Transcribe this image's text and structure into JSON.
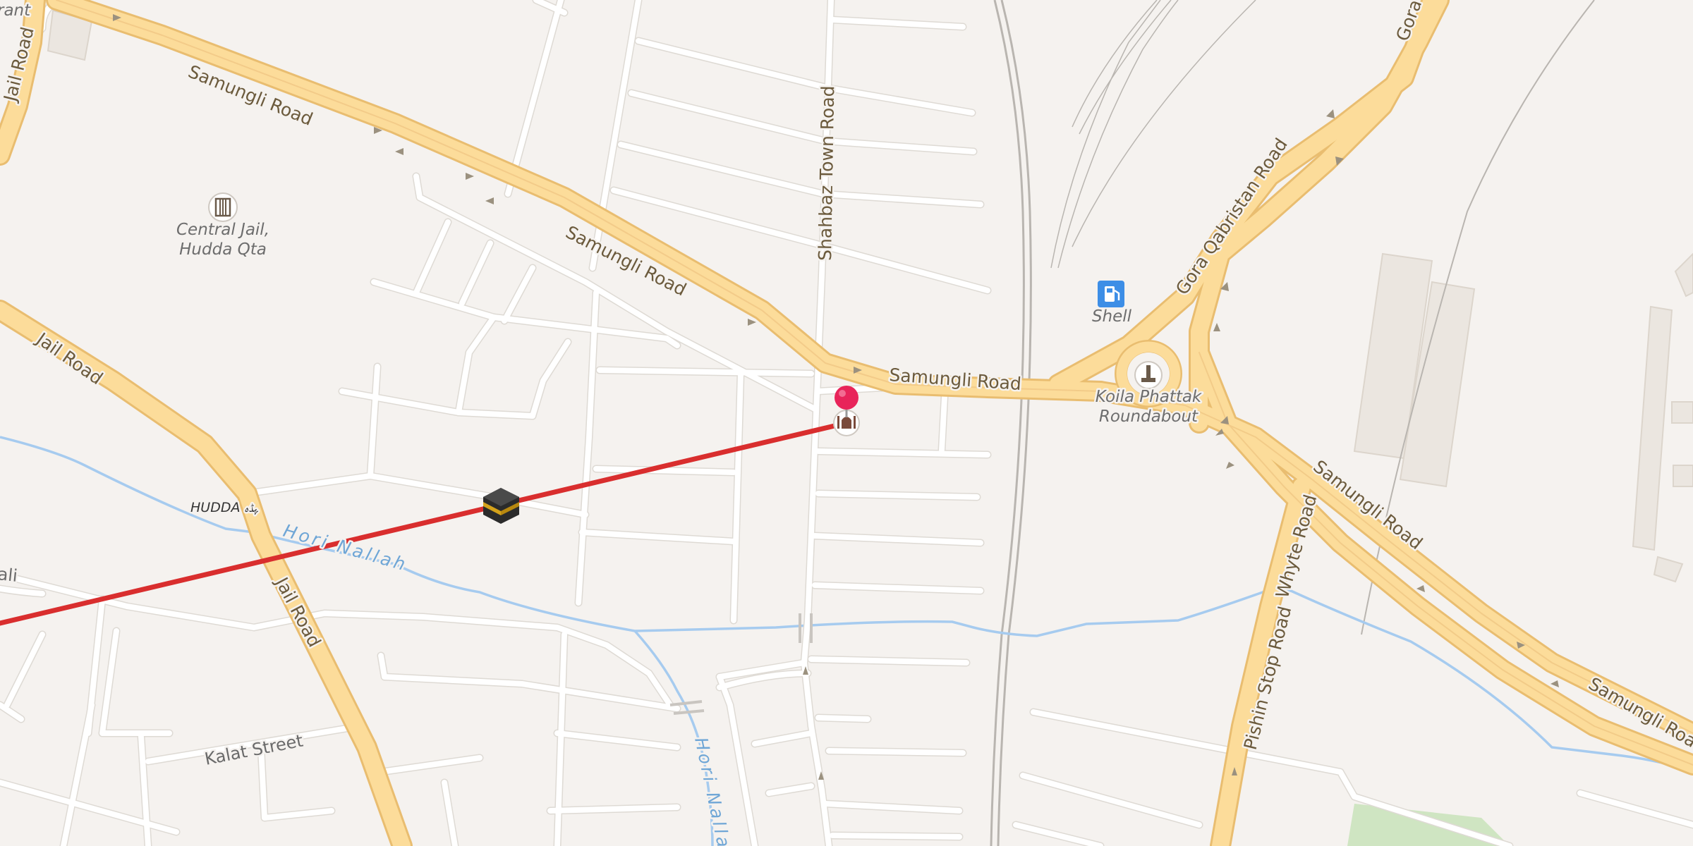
{
  "map": {
    "roads": {
      "samungli_top": "Samungli Road",
      "samungli_mid": "Samungli Road",
      "samungli_center": "Samungli Road",
      "samungli_right": "Samungli Road",
      "samungli_far_right": "Samungli Road",
      "jail_top": "Jail Road",
      "jail_left": "Jail Road",
      "jail_bottom": "Jail Road",
      "shahbaz": "Shahbaz Town Road",
      "gora_qabristan": "Gora Qabristan Road",
      "gora_top": "Gora",
      "whyte": "Whyte Road",
      "pishin": "Pishin Stop Road",
      "kalat": "Kalat Street",
      "partial_left": "ali",
      "partial_top": "rant"
    },
    "water": {
      "hori_nallah": "Hori Nallah",
      "hori_nallah_2": "Hori Nallah"
    },
    "poi": {
      "central_jail_line1": "Central Jail,",
      "central_jail_line2": "Hudda Qta",
      "shell": "Shell",
      "koila_line1": "Koila Phattak",
      "koila_line2": "Roundabout",
      "hudda": "HUDDA ﮩﮉﮦ"
    },
    "colors": {
      "background": "#f5f2ef",
      "major_road": "#fcdc9a",
      "major_road_casing": "#e9bd70",
      "minor_road": "#ffffff",
      "water": "#a6cbef",
      "route_line": "#d92e2e",
      "pin": "#e8245a",
      "fuel_icon": "#3d8ee6",
      "park": "#cfe5c2"
    },
    "icons": [
      "jail-icon",
      "fuel-icon",
      "monument-icon",
      "mosque-icon",
      "location-pin-icon",
      "kaaba-icon"
    ]
  }
}
